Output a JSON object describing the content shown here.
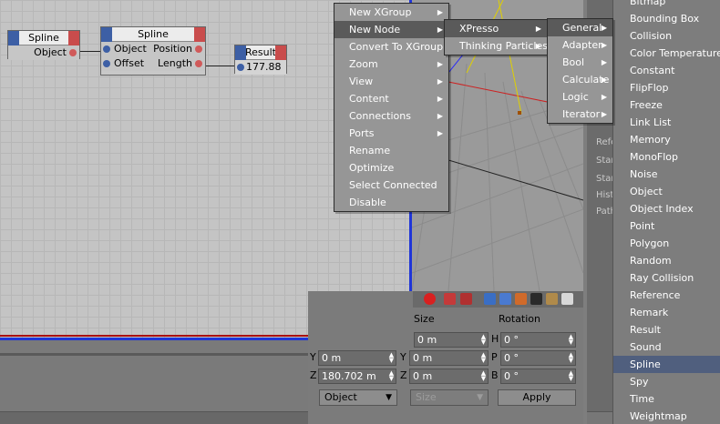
{
  "nodes": {
    "spline_object": {
      "title": "Spline",
      "out_port": "Object"
    },
    "spline_main": {
      "title": "Spline",
      "in_ports": [
        "Object",
        "Offset"
      ],
      "out_ports": [
        "Position",
        "Length"
      ]
    },
    "result": {
      "title": "Result",
      "value": "177.88"
    }
  },
  "context_menu": {
    "items": [
      {
        "label": "New XGroup",
        "has_sub": true
      },
      {
        "label": "New Node",
        "has_sub": true
      },
      {
        "label": "Convert To XGroup",
        "has_sub": false
      },
      {
        "label": "Zoom",
        "has_sub": true
      },
      {
        "label": "View",
        "has_sub": true
      },
      {
        "label": "Content",
        "has_sub": true
      },
      {
        "label": "Connections",
        "has_sub": true
      },
      {
        "label": "Ports",
        "has_sub": true
      },
      {
        "label": "Rename",
        "has_sub": false
      },
      {
        "label": "Optimize",
        "has_sub": false
      },
      {
        "label": "Select Connected",
        "has_sub": false
      },
      {
        "label": "Disable",
        "has_sub": false
      }
    ]
  },
  "submenu_node": {
    "items": [
      {
        "label": "XPresso",
        "has_sub": true
      },
      {
        "label": "Thinking Particles",
        "has_sub": true
      }
    ]
  },
  "submenu_xpresso": {
    "items": [
      {
        "label": "General",
        "has_sub": true
      },
      {
        "label": "Adapter",
        "has_sub": true
      },
      {
        "label": "Bool",
        "has_sub": true
      },
      {
        "label": "Calculate",
        "has_sub": true
      },
      {
        "label": "Logic",
        "has_sub": true
      },
      {
        "label": "Iterator",
        "has_sub": true
      }
    ]
  },
  "general_list": {
    "items": [
      "Bitmap",
      "Bounding Box",
      "Collision",
      "Color Temperature",
      "Constant",
      "FlipFlop",
      "Freeze",
      "Link List",
      "Memory",
      "MonoFlop",
      "Noise",
      "Object",
      "Object Index",
      "Point",
      "Polygon",
      "Random",
      "Ray Collision",
      "Reference",
      "Remark",
      "Result",
      "Sound",
      "Spline",
      "Spy",
      "Time",
      "Weightmap"
    ],
    "selected": "Spline"
  },
  "attr_labels": [
    "Refe",
    "Star",
    "Star",
    "Hist",
    "Path"
  ],
  "coord": {
    "size_header": "Size",
    "rotation_header": "Rotation",
    "rows": [
      {
        "pos_axis": "",
        "pos_value": "",
        "size_axis": "",
        "size_value": "0 m",
        "rot_axis": "H",
        "rot_value": "0 °"
      },
      {
        "pos_axis": "Y",
        "pos_value": "0 m",
        "size_axis": "Y",
        "size_value": "0 m",
        "rot_axis": "P",
        "rot_value": "0 °"
      },
      {
        "pos_axis": "Z",
        "pos_value": "180.702 m",
        "size_axis": "Z",
        "size_value": "0 m",
        "rot_axis": "B",
        "rot_value": "0 °"
      }
    ],
    "mode_dropdown": "Object",
    "size_dropdown": "Size",
    "apply_label": "Apply"
  },
  "colors": {
    "accent_blue": "#1f35d8",
    "port_in": "#3d5fa5",
    "port_out": "#d05a5a",
    "selection": "#505f7e"
  }
}
